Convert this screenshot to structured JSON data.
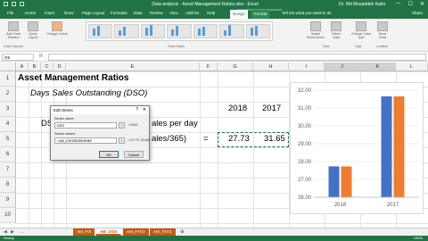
{
  "window": {
    "title": "Data analysis - Asset Management Ratios.xlsx - Excel",
    "chart_tools": "Chart Tools",
    "user": "Dr. Md Mosaddek Kabir",
    "minimize": "—",
    "maximize": "☐",
    "close": "✕"
  },
  "tabs": [
    "File",
    "Home",
    "Insert",
    "Draw",
    "Page Layout",
    "Formulas",
    "Data",
    "Review",
    "View",
    "Add-ins",
    "Help",
    "Design",
    "Format"
  ],
  "tell_me": "Tell me what you want to do",
  "share": "Share",
  "ribbon": {
    "add_chart_element": "Add Chart Element",
    "quick_layout": "Quick Layout",
    "change_colors": "Change Colors",
    "switch_row_col": "Switch Row/Column",
    "select_data": "Select Data",
    "change_chart_type": "Change Chart Type",
    "move_chart": "Move Chart",
    "groups": {
      "chart_layouts": "Chart Layouts",
      "chart_styles": "Chart Styles",
      "data": "Data",
      "type": "Type",
      "location": "Location"
    }
  },
  "formula_bar": {
    "name_box": "G5",
    "fx": "fx",
    "content": ""
  },
  "columns": [
    "A",
    "B",
    "C",
    "D",
    "E",
    "F",
    "G",
    "H",
    "I",
    "J",
    "K",
    "L"
  ],
  "rows": [
    "1",
    "2",
    "3",
    "4",
    "5",
    "6",
    "7",
    "8",
    "9",
    "10"
  ],
  "cells": {
    "title": "Asset Management Ratios",
    "subtitle": "Days Sales Outstanding (DSO)",
    "year1": "2018",
    "year2": "2017",
    "dso_label": "DS",
    "sales_per_day": "ales per day",
    "sales_365": "ales/365)",
    "equals": "=",
    "dso_2018": "27.73",
    "dso_2017": "31.65"
  },
  "dialog": {
    "title": "Edit Series",
    "help": "?",
    "close": "✕",
    "series_name_label": "Series name:",
    "series_name_value": "DSO",
    "series_name_preview": "= DSO",
    "series_values_label": "Series values:",
    "series_values_value": "=AM_DSO!$G$5:$H$5",
    "series_values_preview": "= 27.73, 31.65",
    "collapse_glyph": "↑",
    "ok": "OK",
    "cancel": "Cancel"
  },
  "sheets": [
    "AM_FIX",
    "AM_DSO",
    "AM_FATO",
    "AM_TATO"
  ],
  "active_sheet": "AM_DSO",
  "status": {
    "ready": "Ready",
    "zoom": "100%"
  },
  "colors": {
    "excel_green": "#217346",
    "tab_orange": "#c55a11",
    "series_blue": "#4472c4",
    "series_orange": "#ed7d31"
  },
  "chart_data": {
    "type": "bar",
    "categories": [
      "2018",
      "2017"
    ],
    "series": [
      {
        "values": [
          27.73,
          31.65
        ]
      },
      {
        "values": [
          27.73,
          31.65
        ]
      }
    ],
    "ylim": [
      26.0,
      32.0
    ],
    "yticks": [
      "32.00",
      "31.00",
      "30.00",
      "29.00",
      "28.00",
      "27.00",
      "26.00"
    ],
    "grid": true,
    "title": "",
    "xlabel": "",
    "ylabel": ""
  }
}
